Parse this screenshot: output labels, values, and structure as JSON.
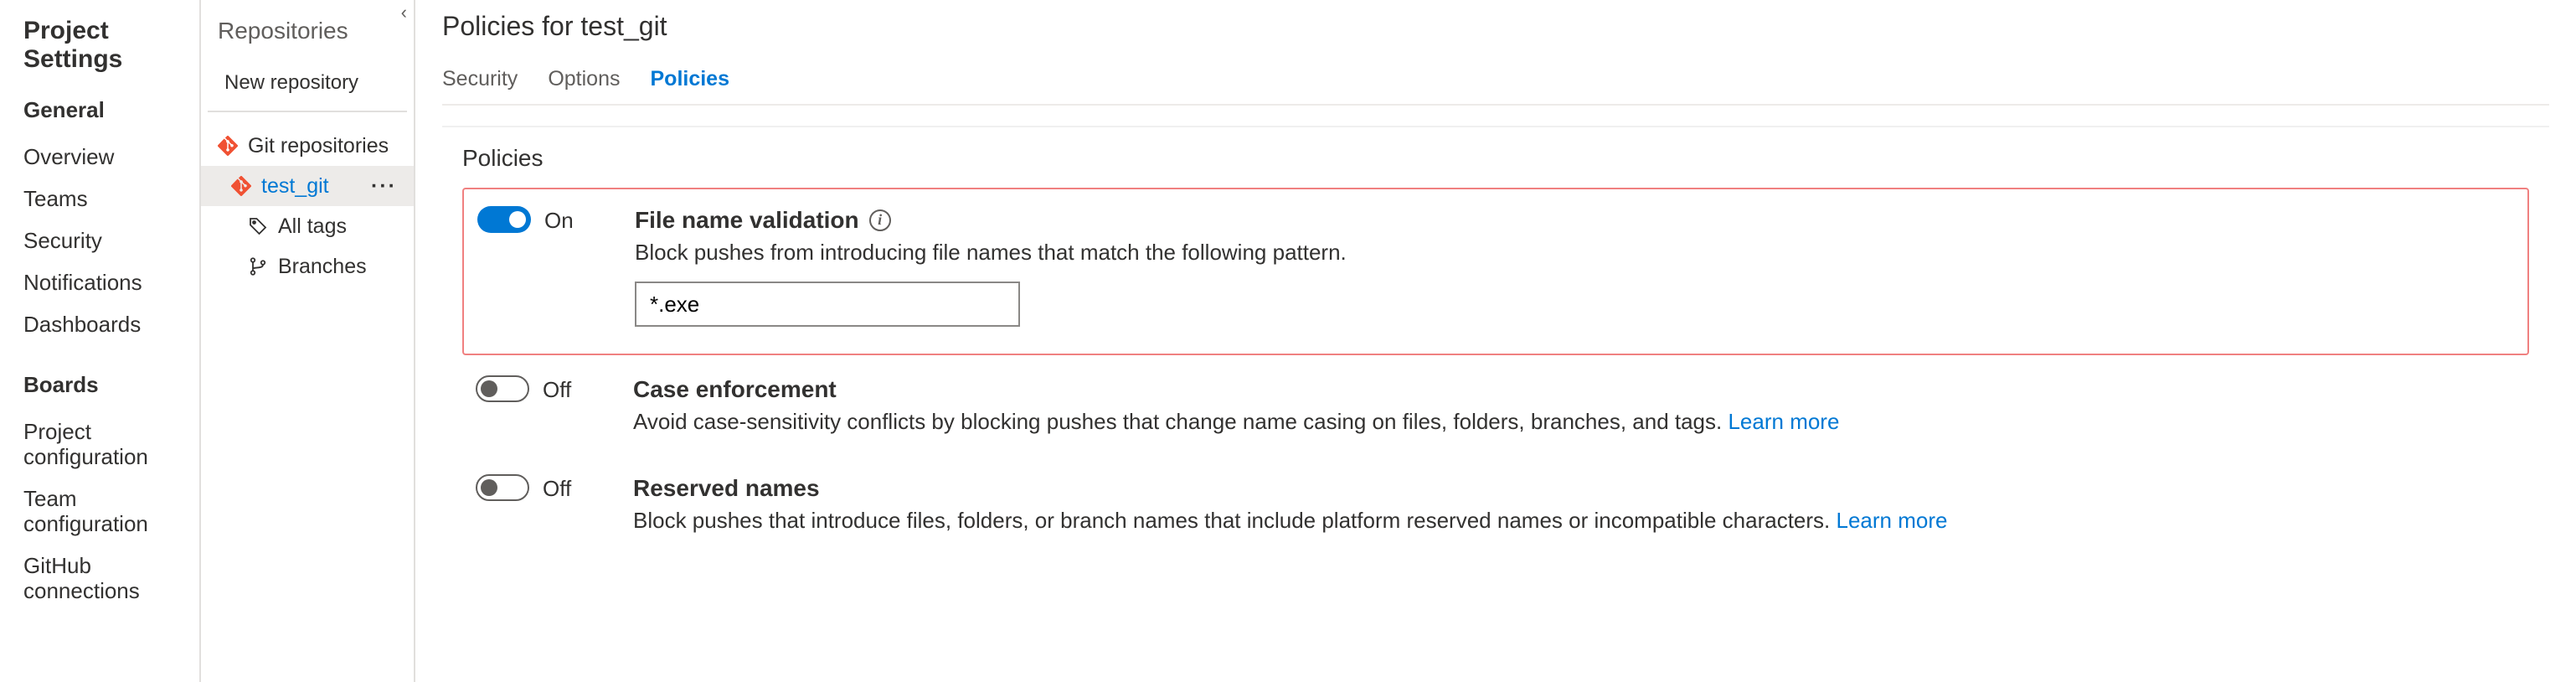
{
  "sidebar": {
    "title": "Project Settings",
    "sections": [
      {
        "heading": "General",
        "items": [
          "Overview",
          "Teams",
          "Security",
          "Notifications",
          "Dashboards"
        ]
      },
      {
        "heading": "Boards",
        "items": [
          "Project configuration",
          "Team configuration",
          "GitHub connections"
        ]
      }
    ]
  },
  "repoPanel": {
    "title": "Repositories",
    "newRepo": "New repository",
    "tree": {
      "root": "Git repositories",
      "selected": "test_git",
      "children": [
        {
          "icon": "tag",
          "label": "All tags"
        },
        {
          "icon": "branch",
          "label": "Branches"
        }
      ]
    }
  },
  "main": {
    "title": "Policies for test_git",
    "tabs": [
      "Security",
      "Options",
      "Policies"
    ],
    "activeTab": 2,
    "panelHeading": "Policies",
    "policies": [
      {
        "on": true,
        "stateLabel": "On",
        "title": "File name validation",
        "hasInfo": true,
        "desc": "Block pushes from introducing file names that match the following pattern.",
        "inputValue": "*.exe",
        "highlighted": true
      },
      {
        "on": false,
        "stateLabel": "Off",
        "title": "Case enforcement",
        "hasInfo": false,
        "desc": "Avoid case-sensitivity conflicts by blocking pushes that change name casing on files, folders, branches, and tags. ",
        "learnMore": "Learn more",
        "highlighted": false
      },
      {
        "on": false,
        "stateLabel": "Off",
        "title": "Reserved names",
        "hasInfo": false,
        "desc": "Block pushes that introduce files, folders, or branch names that include platform reserved names or incompatible characters. ",
        "learnMore": "Learn more",
        "highlighted": false
      }
    ]
  }
}
